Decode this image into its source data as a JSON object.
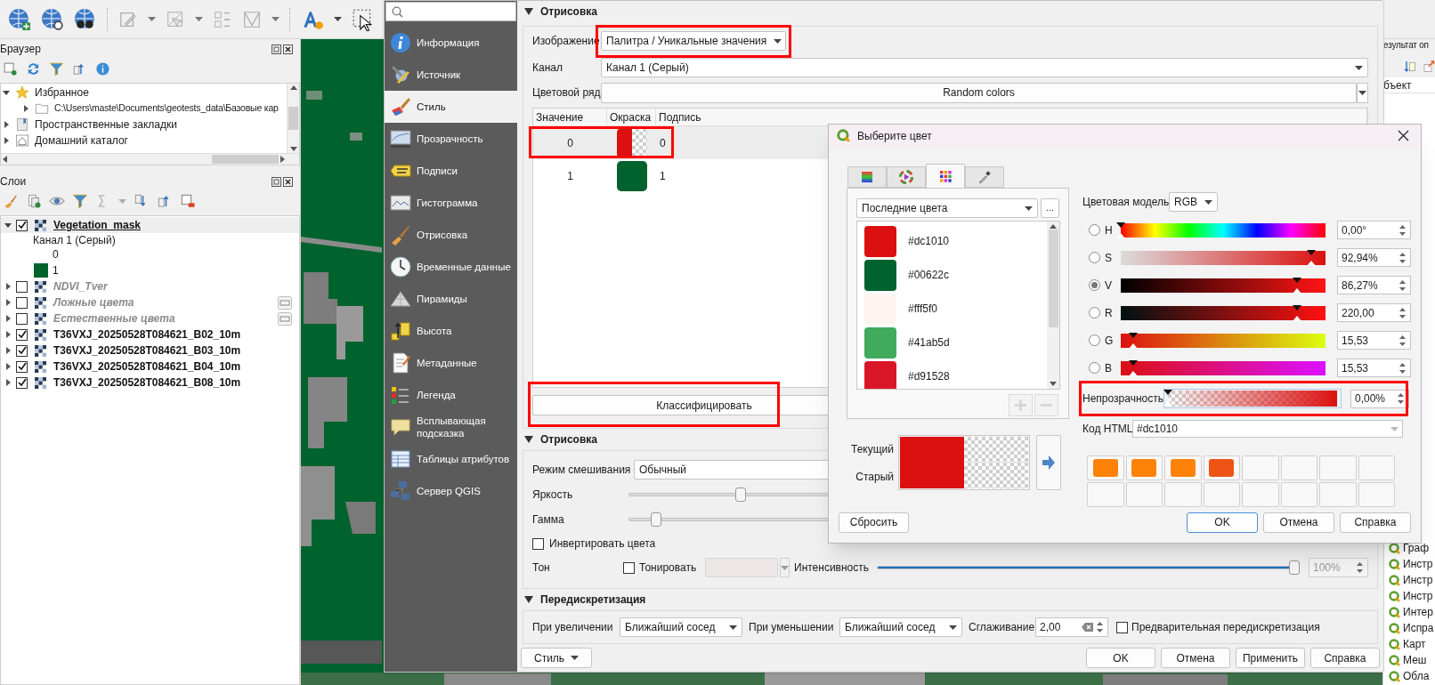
{
  "browser_panel": {
    "title": "Браузер",
    "items": [
      {
        "label": "Избранное",
        "kind": "favorites",
        "expanded": true,
        "children": [
          {
            "label": "C:\\Users\\maste\\Documents\\geotests_data\\Базовые кар",
            "kind": "folder",
            "expanded": false
          }
        ]
      },
      {
        "label": "Пространственные закладки",
        "kind": "bookmarks",
        "expanded": false
      },
      {
        "label": "Домашний каталог",
        "kind": "home",
        "expanded": false
      }
    ]
  },
  "layers_panel": {
    "title": "Слои",
    "layers": [
      {
        "name": "Vegetation_mask",
        "checked": true,
        "selected": true,
        "expanded": true,
        "indicator": false,
        "legend": {
          "band": "Канал 1 (Серый)",
          "entries": [
            {
              "label": "0"
            },
            {
              "label": "1",
              "color": "#00622c"
            }
          ]
        }
      },
      {
        "name": "NDVI_Tver",
        "checked": false,
        "selected": false,
        "expanded": false,
        "indicator": false
      },
      {
        "name": "Ложные цвета",
        "checked": false,
        "selected": false,
        "expanded": false,
        "indicator": true
      },
      {
        "name": "Естественные цвета",
        "checked": false,
        "selected": false,
        "expanded": false,
        "indicator": true
      },
      {
        "name": "T36VXJ_20250528T084621_B02_10m",
        "checked": true,
        "selected": false,
        "expanded": false,
        "indicator": false
      },
      {
        "name": "T36VXJ_20250528T084621_B03_10m",
        "checked": true,
        "selected": false,
        "expanded": false,
        "indicator": false
      },
      {
        "name": "T36VXJ_20250528T084621_B04_10m",
        "checked": true,
        "selected": false,
        "expanded": false,
        "indicator": false
      },
      {
        "name": "T36VXJ_20250528T084621_B08_10m",
        "checked": true,
        "selected": false,
        "expanded": false,
        "indicator": false
      }
    ]
  },
  "right_dock": {
    "header": "езультат оп",
    "column": "бъект",
    "items": [
      "Граф",
      "Инстр",
      "Инстр",
      "Инстр",
      "Интер",
      "Испра",
      "Карт",
      "Меш",
      "Обла"
    ]
  },
  "sidebar": [
    {
      "label": "Информация",
      "kind": "info",
      "selected": false
    },
    {
      "label": "Источник",
      "kind": "source",
      "selected": false
    },
    {
      "label": "Стиль",
      "kind": "style",
      "selected": true
    },
    {
      "label": "Прозрачность",
      "kind": "transparency",
      "selected": false
    },
    {
      "label": "Подписи",
      "kind": "labels",
      "selected": false
    },
    {
      "label": "Гистограмма",
      "kind": "histogram",
      "selected": false
    },
    {
      "label": "Отрисовка",
      "kind": "rendering",
      "selected": false
    },
    {
      "label": "Временные данные",
      "kind": "temporal",
      "selected": false
    },
    {
      "label": "Пирамиды",
      "kind": "pyramids",
      "selected": false
    },
    {
      "label": "Высота",
      "kind": "elevation",
      "selected": false
    },
    {
      "label": "Метаданные",
      "kind": "metadata",
      "selected": false
    },
    {
      "label": "Легенда",
      "kind": "legend",
      "selected": false
    },
    {
      "label": "Всплывающая подсказка",
      "kind": "tooltip",
      "selected": false
    },
    {
      "label": "Таблицы атрибутов",
      "kind": "attributes",
      "selected": false
    },
    {
      "label": "Сервер QGIS",
      "kind": "server",
      "selected": false
    }
  ],
  "symbology": {
    "title": "Отрисовка",
    "expanded": true,
    "renderer": {
      "label": "Изображение",
      "value": "Палитра / Уникальные значения",
      "highlighted": true
    },
    "band": {
      "label": "Канал",
      "value": "Канал 1 (Серый)"
    },
    "color_ramp": {
      "label": "Цветовой ряд",
      "value": "Random colors"
    },
    "table": {
      "columns": [
        "Значение",
        "Окраска",
        "Подпись"
      ],
      "highlighted": true,
      "rows": [
        {
          "value": "0",
          "color": "#dc1010",
          "transparent": true,
          "label": "0",
          "selected": true
        },
        {
          "value": "1",
          "color": "#00622c",
          "transparent": false,
          "label": "1",
          "selected": false
        }
      ]
    },
    "classify": {
      "label": "Классифицировать",
      "highlighted": true
    }
  },
  "rendering": {
    "title": "Отрисовка",
    "expanded": true,
    "blend": {
      "label": "Режим смешивания",
      "value": "Обычный"
    },
    "brightness": {
      "label": "Яркость",
      "level": 0.5
    },
    "gamma": {
      "label": "Гамма",
      "level": 0.12
    },
    "invert": {
      "label": "Инвертировать цвета",
      "checked": false
    },
    "hue": {
      "label": "Тон",
      "colorize": "Тонировать",
      "colorize_checked": false,
      "intensity_label": "Интенсивность",
      "level": 1,
      "reading": "100%"
    }
  },
  "resampling": {
    "title": "Передискретизация",
    "expanded": true,
    "zoomed_in": {
      "label": "При увеличении",
      "value": "Ближайший сосед"
    },
    "zoomed_out": {
      "label": "При уменьшении",
      "value": "Ближайший сосед"
    },
    "oversampling": {
      "label": "Сглаживание",
      "value": "2,00"
    },
    "early": {
      "label": "Предварительная передискретизация",
      "checked": false
    }
  },
  "bottom_bar": {
    "style_button": "Стиль",
    "buttons": [
      "OK",
      "Отмена",
      "Применить",
      "Справка"
    ]
  },
  "color_dialog": {
    "title": "Выберите цвет",
    "tabs": [
      {
        "kind": "ramp",
        "selected": false
      },
      {
        "kind": "wheel",
        "selected": false
      },
      {
        "kind": "swatches",
        "selected": true
      },
      {
        "kind": "picker",
        "selected": false
      }
    ],
    "palette": "Последние цвета",
    "more_button": "...",
    "colors": [
      {
        "label": "#dc1010",
        "color": "#dc1010"
      },
      {
        "label": "#00622c",
        "color": "#00622c"
      },
      {
        "label": "#fff5f0",
        "color": "#fff5f0"
      },
      {
        "label": "#41ab5d",
        "color": "#41ab5d"
      },
      {
        "label": "#d91528",
        "color": "#d91528"
      }
    ],
    "model": {
      "label": "Цветовая модель",
      "value": "RGB"
    },
    "channels": [
      {
        "label": "H",
        "kind": "hue",
        "selected": false,
        "level": 0,
        "reading": "0,00°"
      },
      {
        "label": "S",
        "kind": "saturation",
        "selected": false,
        "level": 0.9294,
        "reading": "92,94%"
      },
      {
        "label": "V",
        "kind": "value",
        "selected": true,
        "level": 0.8627,
        "reading": "86,27%"
      },
      {
        "label": "R",
        "kind": "red",
        "selected": false,
        "level": 0.8627,
        "reading": "220,00"
      },
      {
        "label": "G",
        "kind": "green",
        "selected": false,
        "level": 0.0609,
        "reading": "15,53"
      },
      {
        "label": "B",
        "kind": "blue",
        "selected": false,
        "level": 0.0609,
        "reading": "15,53"
      }
    ],
    "opacity": {
      "label": "Непрозрачность",
      "level": 0,
      "reading": "0,00%",
      "highlighted": true
    },
    "html": {
      "label": "Код HTML",
      "value": "#dc1010"
    },
    "preview": {
      "current_label": "Текущий",
      "old_label": "Старый",
      "color": "#dc1010",
      "transparent": true
    },
    "custom_colors": [
      {
        "color": "#fe8207"
      },
      {
        "color": "#fe8207"
      },
      {
        "color": "#fe8207"
      },
      {
        "color": "#ee5316"
      }
    ],
    "buttons": [
      {
        "label": "Сбросить",
        "kind": "reset",
        "default": false
      },
      {
        "label": "OK",
        "kind": "action",
        "default": true
      },
      {
        "label": "Отмена",
        "kind": "action",
        "default": false
      },
      {
        "label": "Справка",
        "kind": "action",
        "default": false
      }
    ]
  }
}
